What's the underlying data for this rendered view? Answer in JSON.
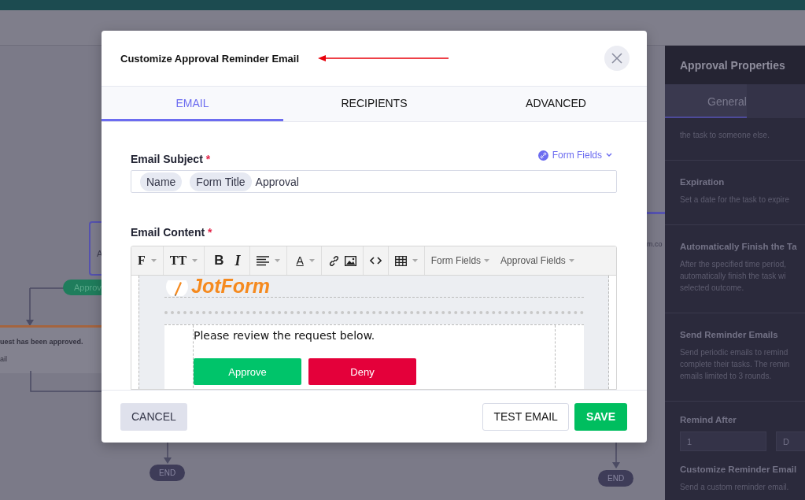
{
  "canvas": {
    "node_text": "A",
    "pill": "Approv",
    "card_title": "uest has been approved.",
    "card_text": "ail",
    "url_fragment": "m.co",
    "end_nodes": [
      "END",
      "END"
    ]
  },
  "properties_panel": {
    "title": "Approval Properties",
    "tabs": [
      {
        "label": "General",
        "selected": true
      }
    ],
    "sections": [
      {
        "description": [
          "the task to someone else."
        ]
      },
      {
        "title": "Expiration",
        "description": [
          "Set a date for the task to expire"
        ]
      },
      {
        "title": "Automatically Finish the Ta",
        "description": [
          "After the specified time period,",
          "automatically finish the task wi",
          "selected outcome."
        ]
      },
      {
        "title": "Send Reminder Emails",
        "description": [
          "Send periodic emails to remind",
          "complete their tasks. The remin",
          "emails limited to 3 rounds."
        ]
      }
    ],
    "remind_after": {
      "label": "Remind After",
      "value": "1",
      "unit": "D"
    },
    "customize": {
      "title": "Customize Reminder Email",
      "description": "Send a custom reminder email."
    }
  },
  "dialog": {
    "title": "Customize Approval Reminder Email",
    "tabs": [
      {
        "label": "EMAIL",
        "selected": true
      },
      {
        "label": "RECIPIENTS",
        "selected": false
      },
      {
        "label": "ADVANCED",
        "selected": false
      }
    ],
    "subject": {
      "label": "Email Subject",
      "required_mark": "*",
      "form_fields": "Form Fields",
      "tokens": [
        "Name",
        "Form Title"
      ],
      "value": "Approval"
    },
    "content": {
      "label": "Email Content",
      "required_mark": "*",
      "toolbar": {
        "font_glyph": "F",
        "size_glyph": "TT",
        "bold_glyph": "B",
        "italic_glyph": "I",
        "color_glyph": "A",
        "dropdowns": [
          "Form Fields",
          "Approval Fields"
        ]
      },
      "preview": {
        "logo": "JotForm",
        "message": "Please review the request below.",
        "buttons": [
          {
            "label": "Approve",
            "color": "#00c46a"
          },
          {
            "label": "Deny",
            "color": "#e4003a"
          }
        ]
      }
    },
    "buttons": {
      "cancel": "CANCEL",
      "test": "TEST EMAIL",
      "save": "SAVE"
    }
  }
}
